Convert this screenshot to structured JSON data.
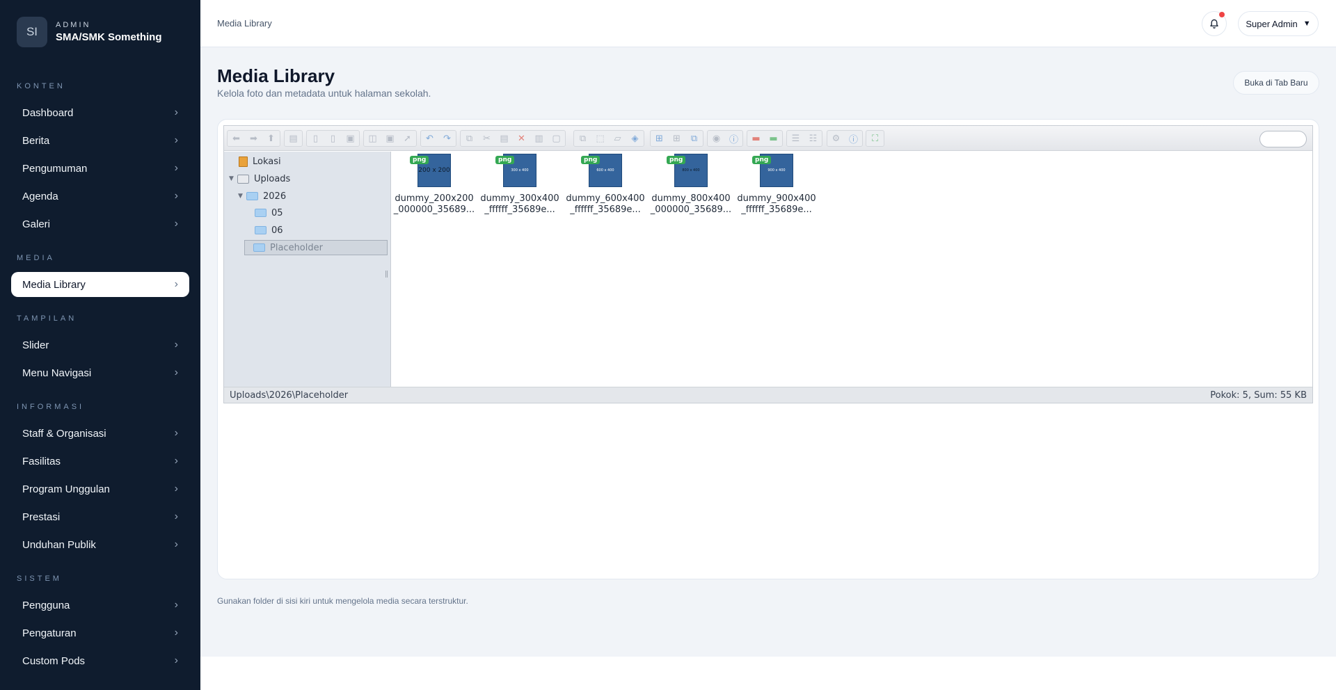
{
  "sidebar": {
    "logo_initials": "SI",
    "eyebrow": "ADMIN",
    "school_name": "SMA/SMK Something",
    "sections": {
      "konten": "KONTEN",
      "media": "MEDIA",
      "tampilan": "TAMPILAN",
      "informasi": "INFORMASI",
      "sistem": "SISTEM"
    },
    "items": {
      "dashboard": "Dashboard",
      "berita": "Berita",
      "pengumuman": "Pengumuman",
      "agenda": "Agenda",
      "galeri": "Galeri",
      "media_library": "Media Library",
      "slider": "Slider",
      "menu_navigasi": "Menu Navigasi",
      "staff": "Staff & Organisasi",
      "fasilitas": "Fasilitas",
      "program": "Program Unggulan",
      "prestasi": "Prestasi",
      "unduhan": "Unduhan Publik",
      "pengguna": "Pengguna",
      "pengaturan": "Pengaturan",
      "custom_pods": "Custom Pods"
    },
    "chevron": "›"
  },
  "topbar": {
    "breadcrumb": "Media Library",
    "user_label": "Super Admin",
    "user_caret": "▼"
  },
  "page": {
    "title": "Media Library",
    "subtitle": "Kelola foto dan metadata untuk halaman sekolah.",
    "open_new_tab": "Buka di Tab Baru",
    "footer_note": "Gunakan folder di sisi kiri untuk mengelola media secara terstruktur."
  },
  "file_manager": {
    "tree": {
      "lokasi": "Lokasi",
      "uploads": "Uploads",
      "year": "2026",
      "month_05": "05",
      "month_06": "06",
      "placeholder": "Placeholder"
    },
    "files": [
      {
        "badge": "png",
        "thumb_text": "200 x 200",
        "line1": "dummy_200x200",
        "line2": "_000000_35689..."
      },
      {
        "badge": "png",
        "thumb_text": "300 x 400",
        "line1": "dummy_300x400",
        "line2": "_ffffff_35689e..."
      },
      {
        "badge": "png",
        "thumb_text": "600 x 400",
        "line1": "dummy_600x400",
        "line2": "_ffffff_35689e..."
      },
      {
        "badge": "png",
        "thumb_text": "800 x 400",
        "line1": "dummy_800x400",
        "line2": "_000000_35689..."
      },
      {
        "badge": "png",
        "thumb_text": "900 x 400",
        "line1": "dummy_900x400",
        "line2": "_ffffff_35689e..."
      }
    ],
    "status_path": "Uploads\\2026\\Placeholder",
    "status_summary": "Pokok: 5, Sum: 55 KB",
    "toolbar_icons": [
      "back-icon",
      "forward-icon",
      "up-icon",
      "home-icon",
      "open-icon",
      "mkfile-icon",
      "save-icon",
      "mkdir-icon",
      "upload-icon",
      "select-icon",
      "undo-icon",
      "redo-icon",
      "copy-icon",
      "cut-icon",
      "paste-icon",
      "delete-icon",
      "empty-icon",
      "rename-icon",
      "duplicate-icon",
      "extract-icon",
      "archive-icon",
      "resize-icon",
      "icons-view-icon",
      "list-view-icon",
      "columns-view-icon",
      "preview-icon",
      "info-icon",
      "download-icon",
      "sort-icon",
      "list-icon",
      "help-icon",
      "settings-icon",
      "fullscreen-icon"
    ]
  },
  "colors": {
    "sidebar_bg": "#0f1c2e",
    "main_bg": "#f1f4f8",
    "accent_red": "#ef4444",
    "file_badge": "#34a853",
    "thumb_blue": "#34649c"
  }
}
